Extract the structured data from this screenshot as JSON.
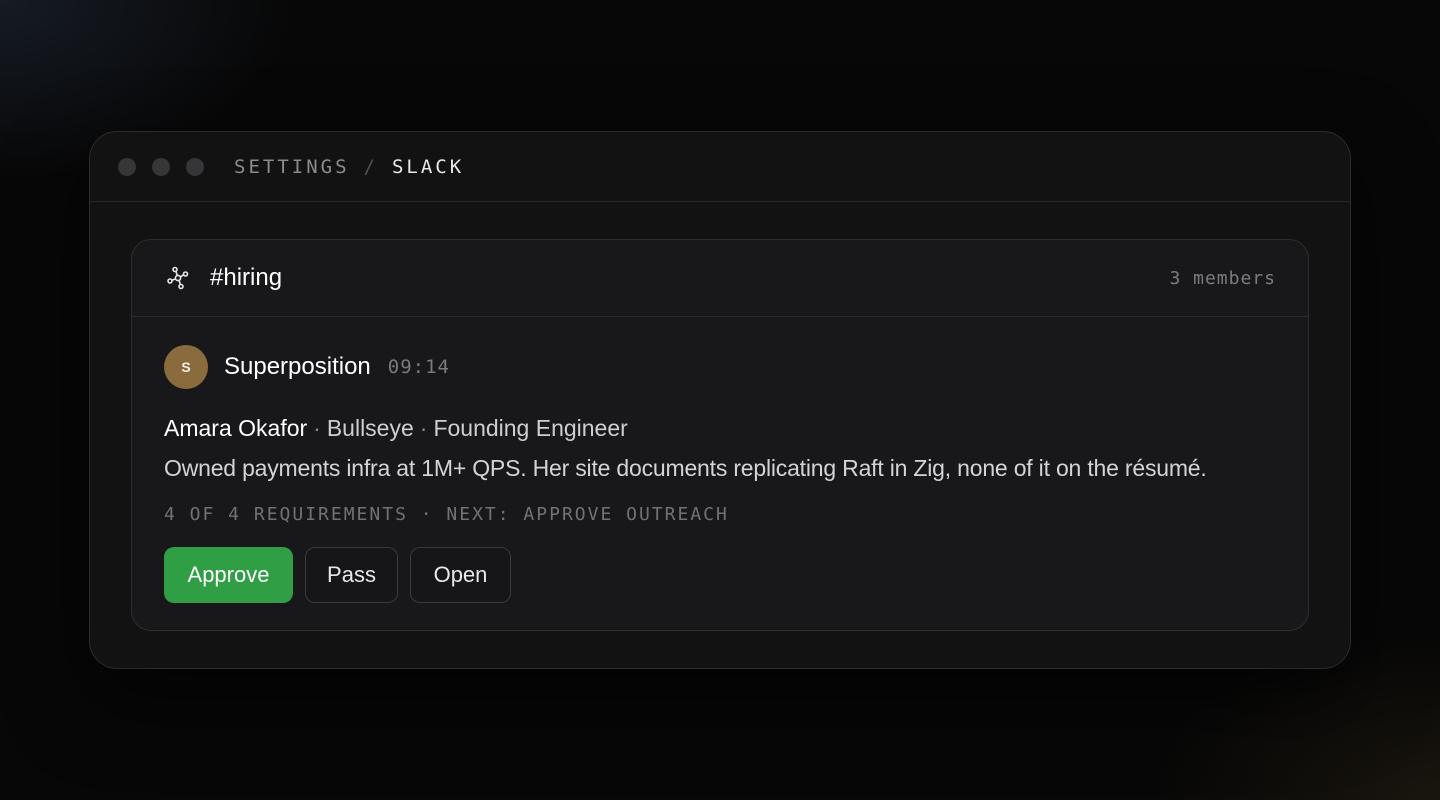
{
  "window": {
    "breadcrumb": {
      "root": "SETTINGS",
      "separator": "/",
      "current": "SLACK"
    }
  },
  "channel": {
    "icon": "hub-network-icon",
    "name": "#hiring",
    "members": "3 members"
  },
  "message": {
    "avatar_initial": "S",
    "avatar_color": "#8a6b3e",
    "sender": "Superposition",
    "time": "09:14",
    "candidate": {
      "name": "Amara Okafor",
      "separator": "·",
      "company": "Bullseye",
      "role": "Founding Engineer"
    },
    "summary": "Owned payments infra at 1M+ QPS. Her site documents replicating Raft in Zig, none of it on the résumé.",
    "status": "4 OF 4 REQUIREMENTS · NEXT: APPROVE OUTREACH",
    "actions": {
      "approve": "Approve",
      "pass": "Pass",
      "open": "Open"
    }
  },
  "colors": {
    "accent_green": "#2f9e44",
    "background": "#070707",
    "panel": "#18181a"
  }
}
